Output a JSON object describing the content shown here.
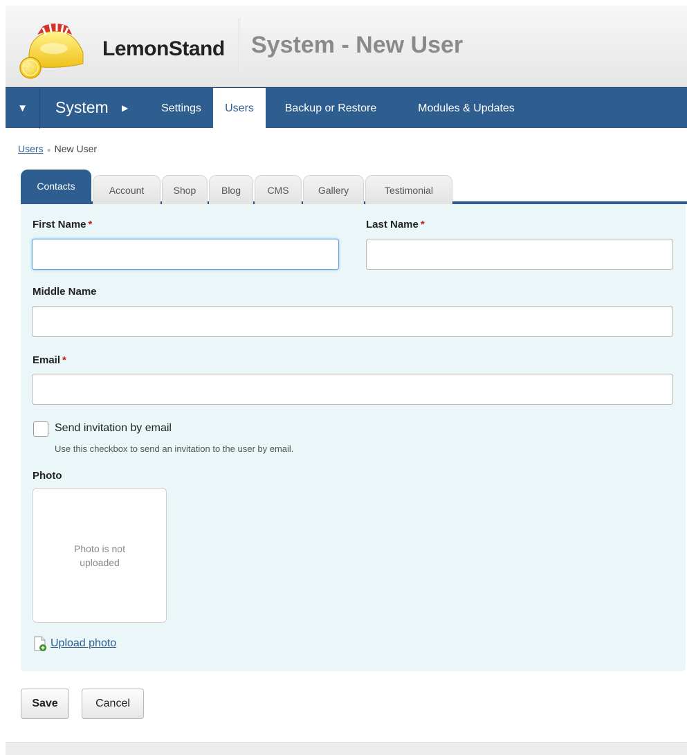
{
  "header": {
    "brand": "LemonStand",
    "page_title": "System - New User"
  },
  "nav": {
    "section": "System",
    "items": [
      {
        "label": "Settings"
      },
      {
        "label": "Users"
      },
      {
        "label": "Backup or Restore"
      },
      {
        "label": "Modules & Updates"
      }
    ],
    "active": "Users"
  },
  "breadcrumb": {
    "parent": "Users",
    "current": "New User"
  },
  "tabs": [
    {
      "label": "Contacts"
    },
    {
      "label": "Account"
    },
    {
      "label": "Shop"
    },
    {
      "label": "Blog"
    },
    {
      "label": "CMS"
    },
    {
      "label": "Gallery"
    },
    {
      "label": "Testimonial"
    }
  ],
  "active_tab": "Contacts",
  "form": {
    "first_name_label": "First Name",
    "last_name_label": "Last Name",
    "middle_name_label": "Middle Name",
    "email_label": "Email",
    "required_mark": "*",
    "first_name_value": "",
    "last_name_value": "",
    "middle_name_value": "",
    "email_value": "",
    "invite_label": "Send invitation by email",
    "invite_help": "Use this checkbox to send an invitation to the user by email.",
    "invite_checked": false,
    "photo_label": "Photo",
    "photo_placeholder": "Photo is not uploaded",
    "upload_link": "Upload photo"
  },
  "buttons": {
    "save": "Save",
    "cancel": "Cancel"
  },
  "colors": {
    "nav_blue": "#2e5d8f",
    "panel_bg": "#eaf6f7",
    "required_red": "#c0211b"
  },
  "icons": {
    "logo": "lemonstand-logo-icon",
    "nav_toggle": "triangle-down-icon",
    "nav_arrow": "triangle-right-icon",
    "upload": "file-add-icon"
  }
}
